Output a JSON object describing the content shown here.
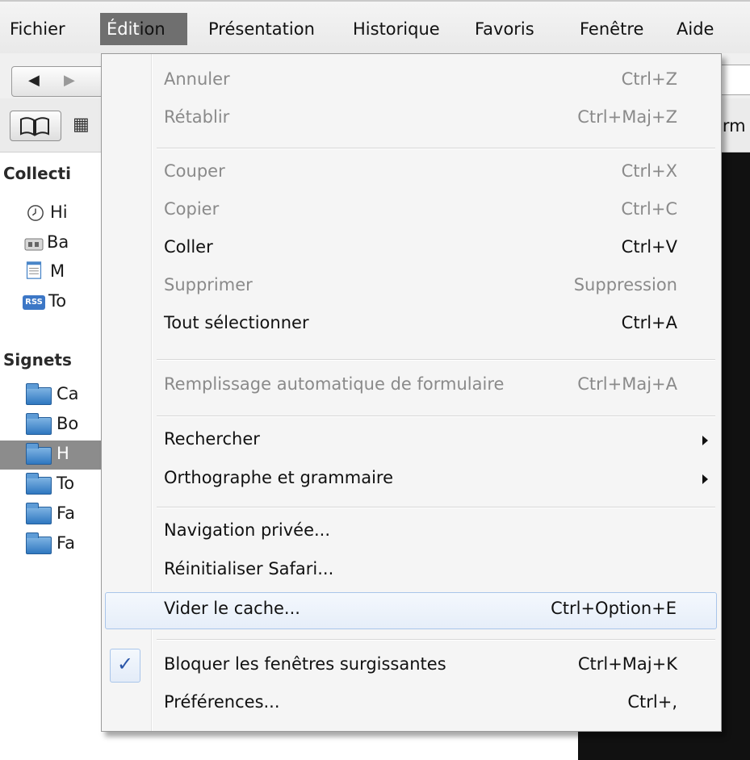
{
  "menubar": {
    "menus": [
      {
        "label": "Fichier"
      },
      {
        "label": "Édition"
      },
      {
        "label": "Présentation"
      },
      {
        "label": "Historique"
      },
      {
        "label": "Favoris"
      },
      {
        "label": "Fenêtre"
      },
      {
        "label": "Aide"
      }
    ],
    "active_menu_head": "Édit",
    "active_menu_tail": "ion"
  },
  "toolbar": {
    "back_glyph": "◀",
    "forward_glyph": "▶",
    "grid_glyph": "▦",
    "fragment_text": "orm"
  },
  "sidebar": {
    "collections_heading": "Collecti",
    "collections": [
      {
        "label": "Hi",
        "icon": "clock-icon"
      },
      {
        "label": "Ba",
        "icon": "bookmarks-bar-icon"
      },
      {
        "label": "M",
        "icon": "menu-list-icon"
      },
      {
        "label": "To",
        "icon": "rss-icon"
      }
    ],
    "bookmarks_heading": "Signets",
    "folders": [
      {
        "label": "Ca",
        "selected": false
      },
      {
        "label": "Bo",
        "selected": false
      },
      {
        "label": "H",
        "selected": true
      },
      {
        "label": "To",
        "selected": false
      },
      {
        "label": "Fa",
        "selected": false
      },
      {
        "label": "Fa",
        "selected": false
      }
    ],
    "rss_badge": "RSS"
  },
  "edit_menu": {
    "items": [
      {
        "label": "Annuler",
        "shortcut": "Ctrl+Z",
        "enabled": false
      },
      {
        "label": "Rétablir",
        "shortcut": "Ctrl+Maj+Z",
        "enabled": false
      },
      {
        "label": "Couper",
        "shortcut": "Ctrl+X",
        "enabled": false
      },
      {
        "label": "Copier",
        "shortcut": "Ctrl+C",
        "enabled": false
      },
      {
        "label": "Coller",
        "shortcut": "Ctrl+V",
        "enabled": true
      },
      {
        "label": "Supprimer",
        "shortcut": "Suppression",
        "enabled": false
      },
      {
        "label": "Tout sélectionner",
        "shortcut": "Ctrl+A",
        "enabled": true
      },
      {
        "label": "Remplissage automatique de formulaire",
        "shortcut": "Ctrl+Maj+A",
        "enabled": false
      },
      {
        "label": "Rechercher",
        "shortcut": "",
        "enabled": true,
        "submenu": true
      },
      {
        "label": "Orthographe et grammaire",
        "shortcut": "",
        "enabled": true,
        "submenu": true
      },
      {
        "label": "Navigation privée...",
        "shortcut": "",
        "enabled": true
      },
      {
        "label": "Réinitialiser Safari...",
        "shortcut": "",
        "enabled": true
      },
      {
        "label": "Vider le cache...",
        "shortcut": "Ctrl+Option+E",
        "enabled": true,
        "highlighted": true
      },
      {
        "label": "Bloquer les fenêtres surgissantes",
        "shortcut": "Ctrl+Maj+K",
        "enabled": true,
        "checked": true
      },
      {
        "label": "Préférences...",
        "shortcut": "Ctrl+,",
        "enabled": true
      }
    ],
    "check_glyph": "✓"
  },
  "colors": {
    "active_menu_bg": "#6f6f6f",
    "highlight_border": "#a9c5ea",
    "disabled_text": "#8a8a8a",
    "selected_row_bg": "#8c8c8c"
  }
}
